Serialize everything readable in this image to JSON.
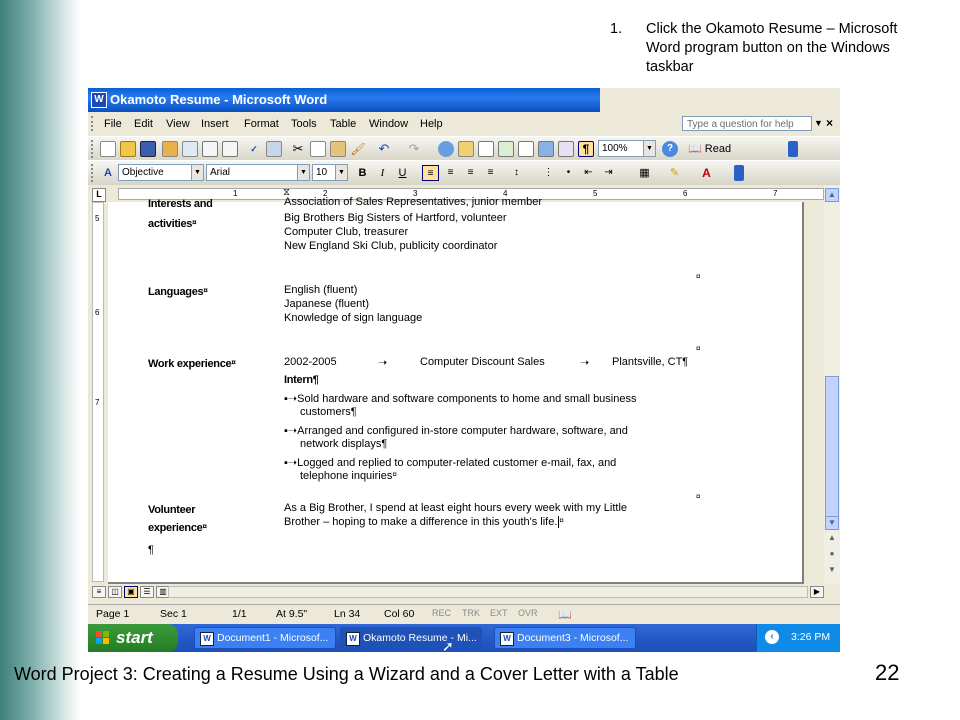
{
  "slide": {
    "callout_number": "1.",
    "callout_text": "Click the Okamoto Resume – Microsoft Word program button on the Windows taskbar",
    "footer": "Word Project 3: Creating a Resume Using a Wizard and a Cover Letter with a Table",
    "page_number": "22"
  },
  "window": {
    "title": "Okamoto Resume - Microsoft Word"
  },
  "menubar": {
    "items": [
      "File",
      "Edit",
      "View",
      "Insert",
      "Format",
      "Tools",
      "Table",
      "Window",
      "Help"
    ],
    "ask_placeholder": "Type a question for help"
  },
  "standard_toolbar": {
    "zoom": "100%",
    "read_label": "Read"
  },
  "formatting_toolbar": {
    "style": "Objective",
    "font": "Arial",
    "size": "10",
    "bold": "B",
    "italic": "I",
    "underline": "U"
  },
  "ruler": {
    "numbers": [
      "1",
      "2",
      "3",
      "4",
      "5",
      "6",
      "7"
    ],
    "vnumbers": [
      "5",
      "6",
      "7"
    ]
  },
  "document": {
    "interests_label_line1": "Interests and",
    "interests_label_line2": "activities",
    "interests_lines": [
      "Association of Sales Representatives, junior member",
      "Big Brothers Big Sisters of Hartford, volunteer",
      "Computer Club, treasurer",
      "New England Ski Club, publicity coordinator"
    ],
    "languages_label": "Languages",
    "languages_lines": [
      "English (fluent)",
      "Japanese (fluent)",
      "Knowledge of sign language"
    ],
    "work_label": "Work experience",
    "work_years": "2002-2005",
    "work_company": "Computer Discount Sales",
    "work_location": "Plantsville, CT",
    "work_title": "Intern",
    "bullets": [
      [
        "Sold hardware and software components to home and small business",
        "customers"
      ],
      [
        "Arranged and configured in-store computer hardware, software, and",
        "network displays"
      ],
      [
        "Logged and replied to computer-related customer e-mail, fax, and",
        "telephone inquiries"
      ]
    ],
    "volunteer_label_line1": "Volunteer",
    "volunteer_label_line2": "experience",
    "volunteer_lines": [
      "As a Big Brother, I spend at least eight hours every week with my Little",
      "Brother – hoping to make a difference in this youth's life."
    ],
    "pilcrow": "¶",
    "cell_mark": "¤"
  },
  "statusbar": {
    "page": "Page 1",
    "sec": "Sec 1",
    "pages": "1/1",
    "at": "At 9.5\"",
    "ln": "Ln 34",
    "col": "Col 60",
    "modes": [
      "REC",
      "TRK",
      "EXT",
      "OVR"
    ]
  },
  "taskbar": {
    "start": "start",
    "tasks": [
      "Document1 - Microsof...",
      "Okamoto Resume - Mi...",
      "Document3 - Microsof..."
    ],
    "clock": "3:26 PM"
  }
}
